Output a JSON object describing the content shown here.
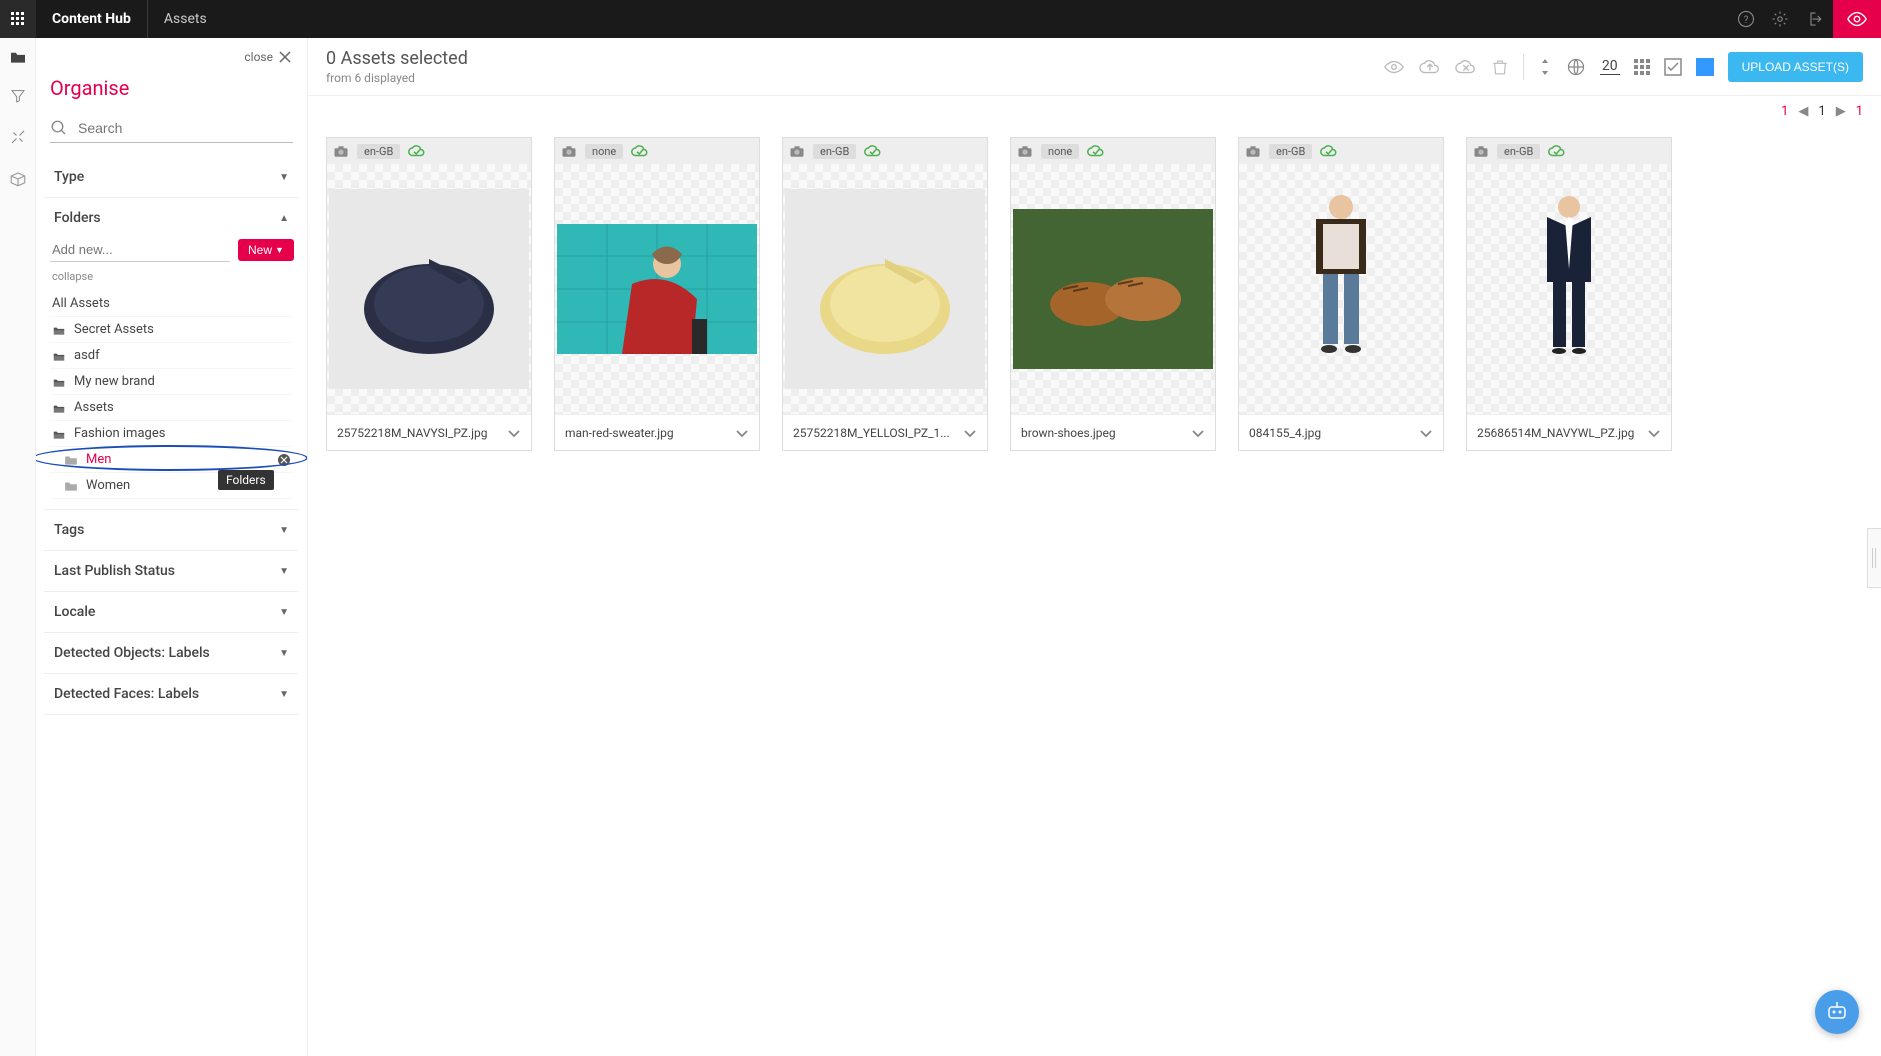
{
  "topbar": {
    "brand": "Content Hub",
    "title": "Assets"
  },
  "sidebar": {
    "close_label": "close",
    "title": "Organise",
    "search_placeholder": "Search",
    "new_placeholder": "Add new...",
    "new_btn": "New",
    "collapse": "collapse",
    "all_assets": "All Assets",
    "tooltip": "Folders",
    "filters": {
      "type": "Type",
      "folders": "Folders",
      "tags": "Tags",
      "last_publish": "Last Publish Status",
      "locale": "Locale",
      "objects": "Detected Objects: Labels",
      "faces": "Detected Faces: Labels"
    },
    "folders": [
      {
        "name": "Secret Assets",
        "sub": false
      },
      {
        "name": "asdf",
        "sub": false
      },
      {
        "name": "My new brand",
        "sub": false
      },
      {
        "name": "Assets",
        "sub": false
      },
      {
        "name": "Fashion images",
        "sub": false
      },
      {
        "name": "Men",
        "sub": true,
        "active": true
      },
      {
        "name": "Women",
        "sub": true
      }
    ]
  },
  "header": {
    "selected": "0 Assets selected",
    "displayed": "from 6 displayed",
    "page_size": "20",
    "upload": "UPLOAD ASSET(S)"
  },
  "pagination": {
    "first": "1",
    "current": "1",
    "last": "1"
  },
  "assets": [
    {
      "locale": "en-GB",
      "name": "25752218M_NAVYSI_PZ.jpg"
    },
    {
      "locale": "none",
      "name": "man-red-sweater.jpg"
    },
    {
      "locale": "en-GB",
      "name": "25752218M_YELLOSI_PZ_1..."
    },
    {
      "locale": "none",
      "name": "brown-shoes.jpeg"
    },
    {
      "locale": "en-GB",
      "name": "084155_4.jpg"
    },
    {
      "locale": "en-GB",
      "name": "25686514M_NAVYWL_PZ.jpg"
    }
  ]
}
